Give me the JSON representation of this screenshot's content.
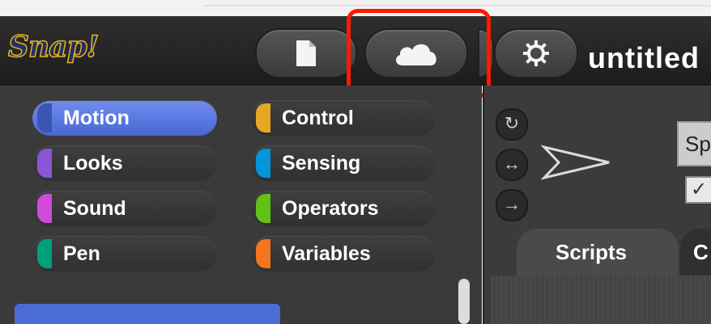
{
  "app": {
    "logo_text": "Snap!",
    "project_title": "untitled"
  },
  "toolbar": {
    "new_project_icon": "file-icon",
    "cloud_icon": "cloud-icon",
    "settings_icon": "gear-icon",
    "highlight_color": "#ff1a00"
  },
  "palette": {
    "categories": [
      {
        "label": "Motion",
        "color": "#4a6cd4",
        "selected": true
      },
      {
        "label": "Control",
        "color": "#e6a822"
      },
      {
        "label": "Looks",
        "color": "#8a55d7"
      },
      {
        "label": "Sensing",
        "color": "#0494dc"
      },
      {
        "label": "Sound",
        "color": "#cf4ad9"
      },
      {
        "label": "Operators",
        "color": "#62c213"
      },
      {
        "label": "Pen",
        "color": "#00a178"
      },
      {
        "label": "Variables",
        "color": "#f3761d"
      }
    ]
  },
  "stage_panel": {
    "sprite_name_partial": "Sp",
    "checkbox_glyph": "✓",
    "tabs": {
      "scripts": "Scripts",
      "costumes_partial": "C"
    }
  }
}
